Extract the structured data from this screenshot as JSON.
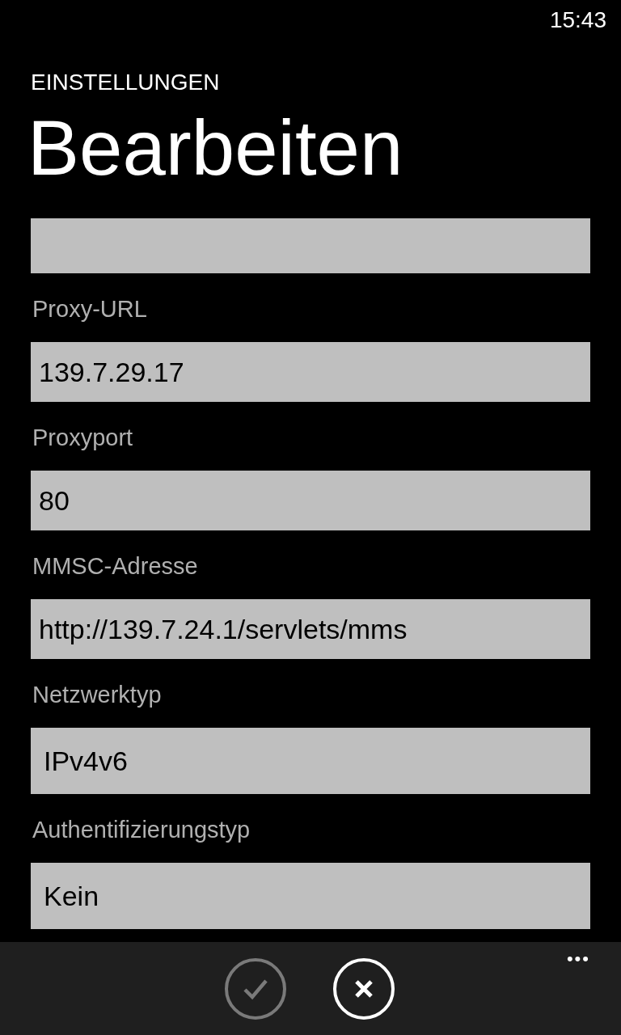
{
  "status_bar": {
    "time": "15:43"
  },
  "header": {
    "app_title": "EINSTELLUNGEN",
    "page_title": "Bearbeiten"
  },
  "fields": [
    {
      "kind": "text"
    },
    {
      "kind": "text",
      "label": "Proxy-URL",
      "value": "139.7.29.17"
    },
    {
      "kind": "text",
      "label": "Proxyport",
      "value": "80"
    },
    {
      "kind": "text",
      "label": "MMSC-Adresse",
      "value": "http://139.7.24.1/servlets/mms"
    },
    {
      "kind": "select",
      "label": "Netzwerktyp",
      "value": "IPv4v6"
    },
    {
      "kind": "select",
      "label": "Authentifizierungstyp",
      "value": "Kein"
    }
  ],
  "app_bar": {
    "buttons": [
      {
        "kind": "save",
        "disabled": true
      },
      {
        "kind": "cancel",
        "disabled": false
      }
    ],
    "more": "•••"
  }
}
